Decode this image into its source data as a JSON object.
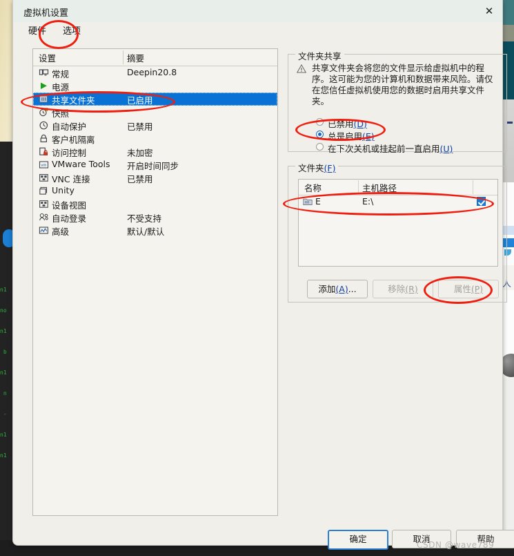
{
  "window": {
    "title": "虚拟机设置",
    "close_icon": "close-icon"
  },
  "tabs": [
    {
      "label": "硬件",
      "selected": false
    },
    {
      "label": "选项",
      "selected": true
    }
  ],
  "settings_list": {
    "columns": [
      "设置",
      "摘要"
    ],
    "rows": [
      {
        "icon": "monitor-icon",
        "name": "常规",
        "summary": "Deepin20.8",
        "selected": false
      },
      {
        "icon": "play-icon",
        "name": "电源",
        "summary": "",
        "selected": false
      },
      {
        "icon": "shared-folder-icon",
        "name": "共享文件夹",
        "summary": "已启用",
        "selected": true
      },
      {
        "icon": "snapshot-clock-icon",
        "name": "快照",
        "summary": "",
        "selected": false
      },
      {
        "icon": "clock-icon",
        "name": "自动保护",
        "summary": "已禁用",
        "selected": false
      },
      {
        "icon": "lock-icon",
        "name": "客户机隔离",
        "summary": "",
        "selected": false
      },
      {
        "icon": "access-lock-icon",
        "name": "访问控制",
        "summary": "未加密",
        "selected": false
      },
      {
        "icon": "vm-tools-icon",
        "name": "VMware Tools",
        "summary": "开启时间同步",
        "selected": false
      },
      {
        "icon": "vnc-icon",
        "name": "VNC 连接",
        "summary": "已禁用",
        "selected": false
      },
      {
        "icon": "unity-icon",
        "name": "Unity",
        "summary": "",
        "selected": false
      },
      {
        "icon": "device-view-icon",
        "name": "设备视图",
        "summary": "",
        "selected": false
      },
      {
        "icon": "auto-login-icon",
        "name": "自动登录",
        "summary": "不受支持",
        "selected": false
      },
      {
        "icon": "advanced-icon",
        "name": "高级",
        "summary": "默认/默认",
        "selected": false
      }
    ]
  },
  "folder_sharing": {
    "legend": "文件夹共享",
    "warning_icon": "warning-triangle-icon",
    "warning_text": "共享文件夹会将您的文件显示给虚拟机中的程序。这可能为您的计算机和数据带来风险。请仅在您信任虚拟机使用您的数据时启用共享文件夹。",
    "options": [
      {
        "label": "已禁用",
        "mnemonic": "(D)",
        "selected": false
      },
      {
        "label": "总是启用",
        "mnemonic": "(E)",
        "selected": true
      },
      {
        "label": "在下次关机或挂起前一直启用",
        "mnemonic": "(U)",
        "selected": false
      }
    ]
  },
  "folders": {
    "legend": "文件夹",
    "legend_mnemonic": "(F)",
    "columns": [
      "名称",
      "主机路径"
    ],
    "rows": [
      {
        "icon": "folder-icon",
        "name": "E",
        "path": "E:\\",
        "enabled": true
      }
    ],
    "buttons": [
      {
        "id": "add",
        "label": "添加",
        "mnemonic": "(A)",
        "suffix": "...",
        "disabled": false
      },
      {
        "id": "remove",
        "label": "移除",
        "mnemonic": "(R)",
        "suffix": "",
        "disabled": true
      },
      {
        "id": "props",
        "label": "属性",
        "mnemonic": "(P)",
        "suffix": "",
        "disabled": true
      }
    ]
  },
  "dialog_buttons": [
    {
      "id": "ok",
      "label": "确定",
      "default": true
    },
    {
      "id": "cancel",
      "label": "取消",
      "default": false
    },
    {
      "id": "help",
      "label": "帮助",
      "default": false
    }
  ],
  "watermark": "CSDN @wave789",
  "colors": {
    "selection_blue": "#0a72d4",
    "accent_blue": "#1268c4",
    "annotation_red": "#ef1e10",
    "dialog_bg": "#f0efe9",
    "titlebar_bg": "#e8eeea"
  }
}
